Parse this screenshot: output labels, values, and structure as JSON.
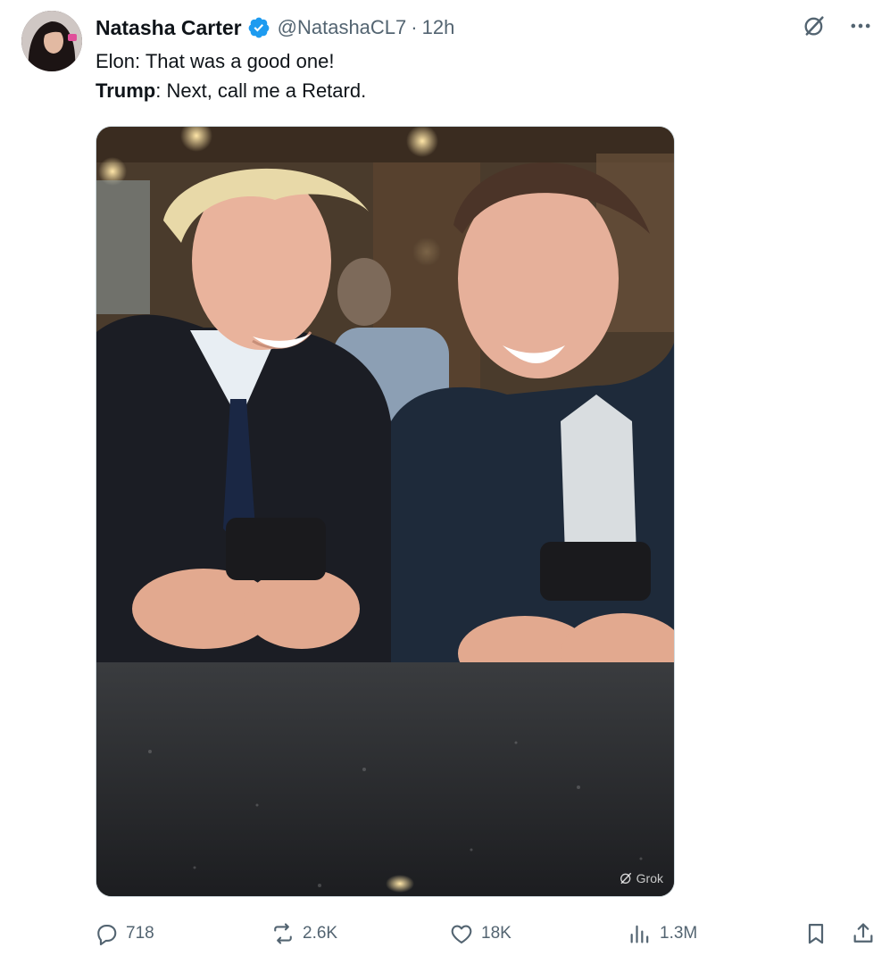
{
  "tweet": {
    "author_name": "Natasha Carter",
    "handle": "@NatashaCL7",
    "separator": "·",
    "time": "12h",
    "text_line1": "Elon: That was a good one!",
    "text_line2_bold": "Trump",
    "text_line2_rest": ": Next, call me a Retard.",
    "media_watermark": "Grok"
  },
  "icons": {
    "verified": "verified-badge-icon",
    "grok": "grok-icon",
    "more": "more-icon",
    "reply": "reply-icon",
    "repost": "repost-icon",
    "like": "like-icon",
    "views": "views-icon",
    "bookmark": "bookmark-icon",
    "share": "share-icon"
  },
  "metrics": {
    "replies": "718",
    "reposts": "2.6K",
    "likes": "18K",
    "views": "1.3M"
  },
  "colors": {
    "text_primary": "#0f1419",
    "text_secondary": "#536471",
    "verified_blue": "#1d9bf0"
  }
}
